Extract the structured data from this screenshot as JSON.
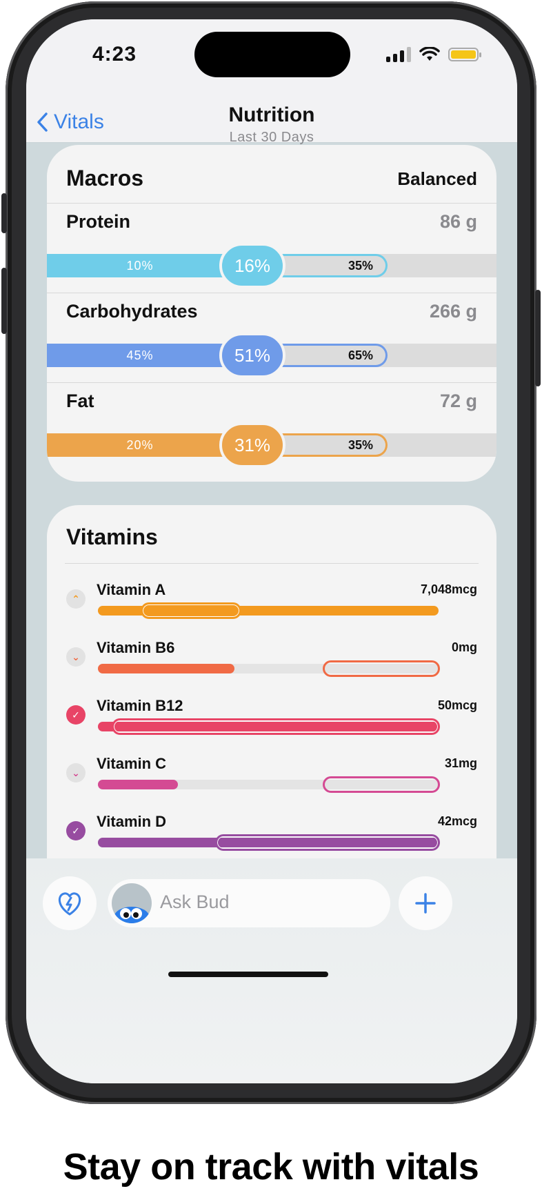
{
  "status": {
    "time": "4:23"
  },
  "nav": {
    "back_label": "Vitals",
    "title": "Nutrition",
    "subtitle": "Last 30 Days"
  },
  "macros": {
    "title": "Macros",
    "status": "Balanced",
    "items": [
      {
        "name": "Protein",
        "amount": "86 g",
        "low": "10%",
        "value": "16%",
        "high": "35%",
        "color": "#6fcde9",
        "value_fraction": 0.16
      },
      {
        "name": "Carbohydrates",
        "amount": "266 g",
        "low": "45%",
        "value": "51%",
        "high": "65%",
        "color": "#6f9be9",
        "value_fraction": 0.51
      },
      {
        "name": "Fat",
        "amount": "72 g",
        "low": "20%",
        "value": "31%",
        "high": "35%",
        "color": "#eca44b",
        "value_fraction": 0.31
      }
    ]
  },
  "vitamins": {
    "title": "Vitamins",
    "items": [
      {
        "name": "Vitamin A",
        "value": "7,048mcg",
        "status": "above",
        "icon": "chevron-up-icon",
        "color": "#f39a1f"
      },
      {
        "name": "Vitamin B6",
        "value": "0mg",
        "status": "below",
        "icon": "chevron-down-icon",
        "color": "#f06a45"
      },
      {
        "name": "Vitamin B12",
        "value": "50mcg",
        "status": "met",
        "icon": "check-icon",
        "color": "#e84466"
      },
      {
        "name": "Vitamin C",
        "value": "31mg",
        "status": "below",
        "icon": "chevron-down-icon",
        "color": "#d44a93"
      },
      {
        "name": "Vitamin D",
        "value": "42mcg",
        "status": "met",
        "icon": "check-icon",
        "color": "#974ca0"
      }
    ]
  },
  "bottom": {
    "ask_placeholder": "Ask Bud"
  },
  "caption": "Stay on track with vitals"
}
